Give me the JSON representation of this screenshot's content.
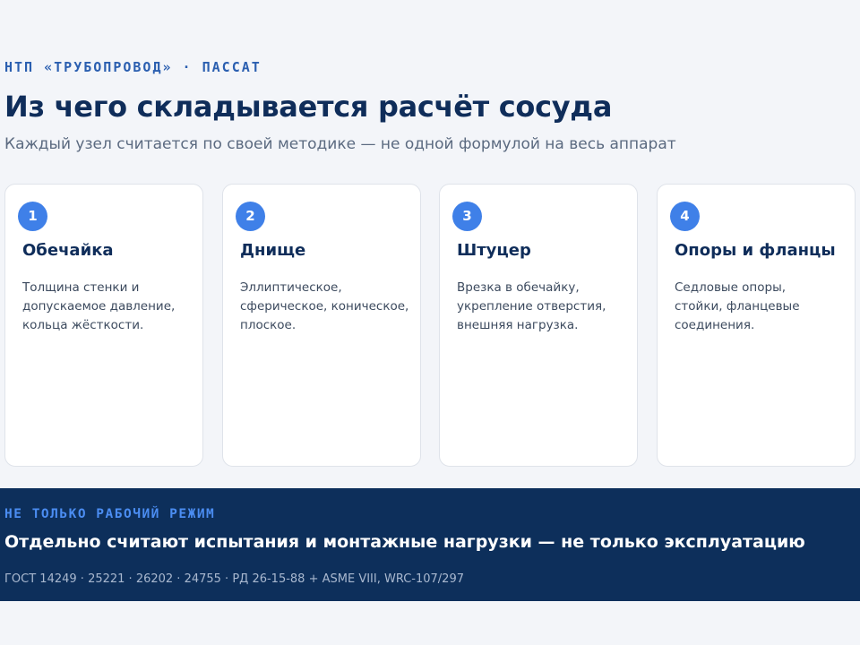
{
  "header": {
    "eyebrow": "НТП «ТРУБОПРОВОД» · ПАССАТ",
    "title": "Из чего складывается расчёт сосуда",
    "subtitle": "Каждый узел считается по своей методике — не одной формулой на весь аппарат"
  },
  "cards": [
    {
      "number": "1",
      "title": "Обечайка",
      "lines": [
        "Толщина стенки и",
        "допускаемое давление,",
        "кольца жёсткости."
      ]
    },
    {
      "number": "2",
      "title": "Днище",
      "lines": [
        "Эллиптическое,",
        "сферическое, коническое,",
        "плоское."
      ]
    },
    {
      "number": "3",
      "title": "Штуцер",
      "lines": [
        "Врезка в обечайку,",
        "укрепление отверстия,",
        "внешняя нагрузка."
      ]
    },
    {
      "number": "4",
      "title": "Опоры и фланцы",
      "lines": [
        "Седловые опоры,",
        "стойки, фланцевые",
        "соединения."
      ]
    }
  ],
  "banner": {
    "eyebrow": "НЕ ТОЛЬКО РАБОЧИЙ РЕЖИМ",
    "title": "Отдельно считают испытания и монтажные нагрузки — не только эксплуатацию",
    "note": "ГОСТ 14249 · 25221 · 26202 · 24755 · РД 26-15-88 + ASME VIII, WRC-107/297"
  },
  "colors": {
    "page_background": "#f3f5f9",
    "accent": "#3f80e8",
    "heading": "#0f2d5a",
    "banner_background": "#0d2f5b",
    "banner_eyebrow": "#4b8df2"
  }
}
